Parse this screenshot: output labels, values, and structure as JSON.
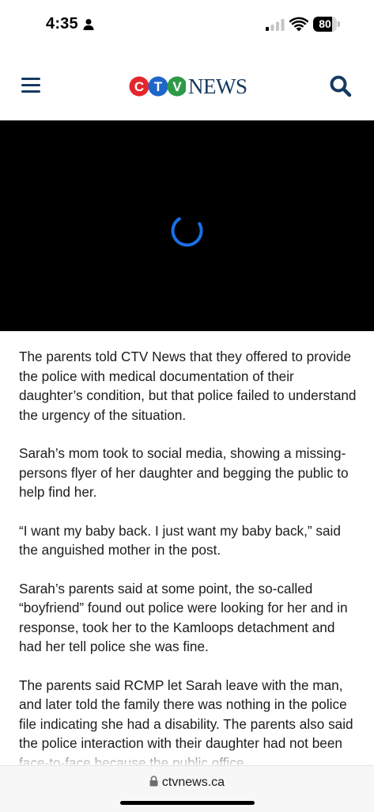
{
  "status_bar": {
    "time": "4:35",
    "battery_level": 80,
    "battery_text": "80",
    "signal_bars_active": 1,
    "signal_bars_total": 4,
    "icons": [
      "person-icon",
      "signal-icon",
      "wifi-icon",
      "battery-icon"
    ]
  },
  "header": {
    "logo_letters": [
      "C",
      "T",
      "V"
    ],
    "logo_text": "NEWS",
    "menu_icon": "hamburger-menu-icon",
    "search_icon": "search-icon"
  },
  "video": {
    "state": "loading",
    "spinner_icon": "loading-spinner-icon"
  },
  "article": {
    "paragraphs": [
      "The parents told CTV News that they offered to provide the police with medical documentation of their daughter’s condition, but that police failed to understand the urgency of the situation.",
      "Sarah’s mom took to social media, showing a missing-persons flyer of her daughter and begging the public to help find her.",
      "“I want my baby back. I just want my baby back,” said the anguished mother in the post.",
      "Sarah’s parents said at some point, the so-called “boyfriend” found out police were looking for her and in response, took her to the Kamloops detachment and had her tell police she was fine.",
      "The parents said RCMP let Sarah leave with the man, and later told the family there was nothing in the police file indicating she had a disability. The parents also said the police interaction with their daughter had not been face-to-face because the public office"
    ]
  },
  "browser": {
    "url": "ctvnews.ca",
    "lock_icon": "lock-icon"
  },
  "colors": {
    "ctv_red": "#e4262c",
    "ctv_blue": "#1e66c9",
    "ctv_green": "#2e9a48",
    "navy": "#163a5f",
    "spinner_blue": "#1a6fe6",
    "video_background": "#000000"
  }
}
